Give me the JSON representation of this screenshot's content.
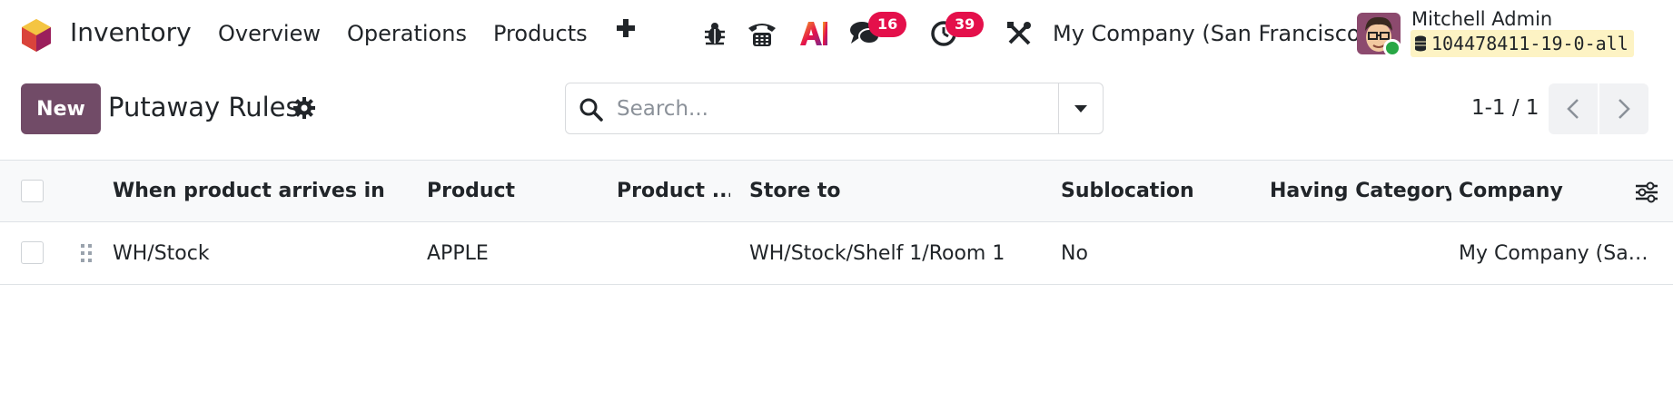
{
  "navbar": {
    "app_name": "Inventory",
    "menu": [
      {
        "label": "Overview"
      },
      {
        "label": "Operations"
      },
      {
        "label": "Products"
      }
    ],
    "icons": [
      "app-logo-icon",
      "plus-icon",
      "bug-icon",
      "phone-icon",
      "ai-icon",
      "chat-icon",
      "activity-clock-icon",
      "tools-icon",
      "database-icon"
    ],
    "chat_badge": "16",
    "activity_badge": "39",
    "company": "My Company (San Francisco)",
    "user_name": "Mitchell Admin",
    "database": "104478411-19-0-all"
  },
  "control_panel": {
    "new_button": "New",
    "title": "Putaway Rules",
    "search_placeholder": "Search...",
    "pager": "1-1 / 1"
  },
  "list": {
    "columns": [
      {
        "key": "location_in",
        "label": "When product arrives in"
      },
      {
        "key": "product",
        "label": "Product"
      },
      {
        "key": "product_category",
        "label": "Product ..."
      },
      {
        "key": "store_to",
        "label": "Store to"
      },
      {
        "key": "sublocation",
        "label": "Sublocation"
      },
      {
        "key": "having_category",
        "label": "Having Category"
      },
      {
        "key": "company",
        "label": "Company"
      }
    ],
    "rows": [
      {
        "location_in": "WH/Stock",
        "product": "APPLE",
        "product_category": "",
        "store_to": "WH/Stock/Shelf 1/Room 1",
        "sublocation": "No",
        "having_category": "",
        "company": "My Company (Sa…"
      }
    ]
  },
  "colors": {
    "primary": "#714b67",
    "badge": "#e4104b",
    "online": "#28a745",
    "db_chip": "#fdf3c4",
    "header_bg": "#f8f9fa"
  }
}
